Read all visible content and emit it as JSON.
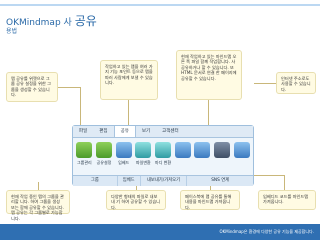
{
  "title": {
    "main": "OKMindmap 사",
    "main_big": "공유",
    "sub": "용법"
  },
  "notes": {
    "left": "맵 공유를 위젯으로 그룹 공유 설정을 위한 그룹을 생성할 수 있습니다.",
    "mid_top": "작업하고 있는 맵을 여러 가지 기능 포인트 등으로 맵을 파러 사람에게 보낼 수 있습니다.",
    "right_top": "현재 작업하고 있는 마인드맵 오른 쪽 파일 함께 작업합니다. 사 공유하거나 할 수 있습니다. 또 HTML 문서로 연결 한 페이지에 공유할 수 있습니다.",
    "far_right": "인터넷 주소로도 사용할 수 있습니다.",
    "bottom_left": "현재 작업 중인 맵의 그룹을 관리할 니다. 하여 그룹을 생성 또는 함께 공유할 수 있습니다. 맵 공유는 각 그룹별로 가능합니다.",
    "bottom_mid": "다양한 형태의 파일로 내보내 기 하여 공유할 수 있습니다.",
    "bottom_midright": "페이스북에 맵 공유를 통해 내용을 마인드맵 가져옵니다.",
    "bottom_right": "임베디드 코드를 마인드맵 가져옵니다."
  },
  "ribbon": {
    "tabs": [
      "파일",
      "편집",
      "공유",
      "보기",
      "고객센터"
    ],
    "buttons": [
      "그룹관리",
      "공유설정",
      "임베드",
      "파일변환",
      "마디 변환",
      "",
      "",
      "",
      ""
    ],
    "groups": [
      "그룹",
      "임베드",
      "내보내기/가져오기",
      "SNS 연계"
    ]
  },
  "footer": "OKMindmap은 환경에 다양한 공유 기능을 제공합니다."
}
